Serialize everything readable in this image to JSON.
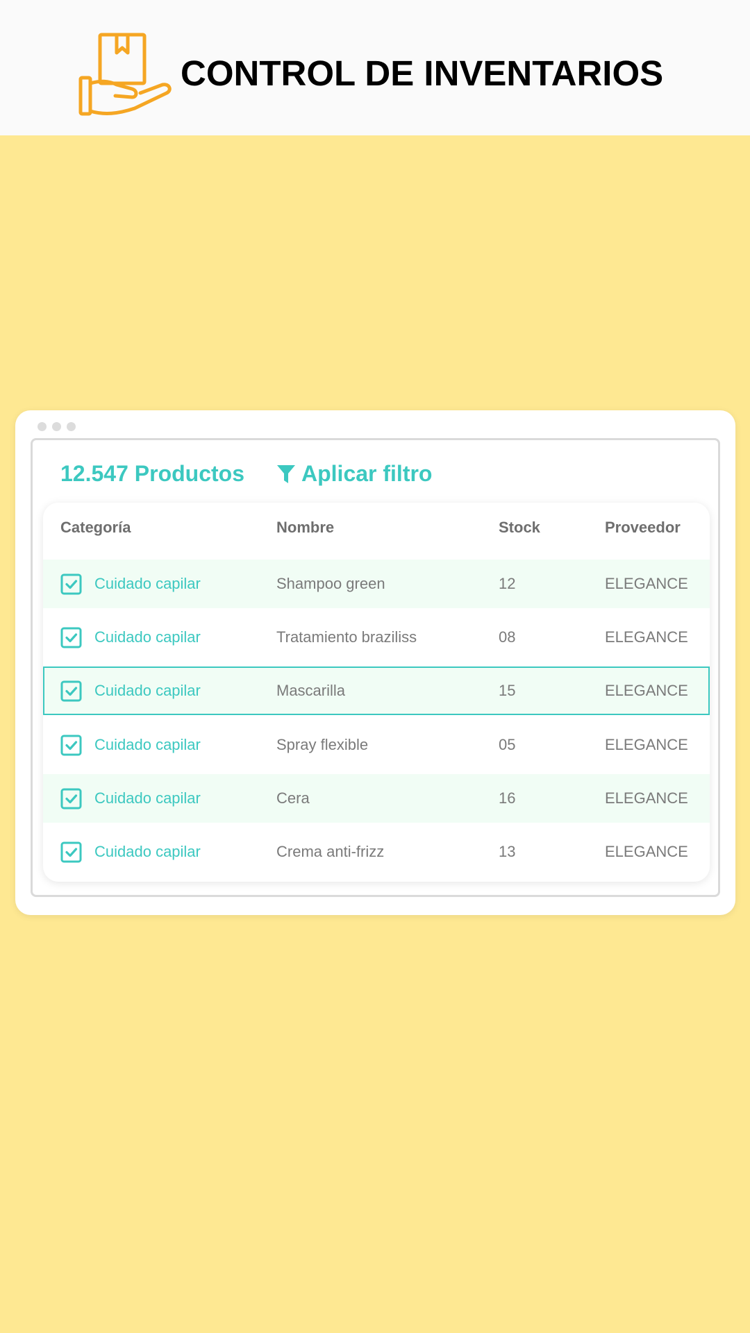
{
  "header": {
    "title": "CONTROL DE INVENTARIOS",
    "logo_icon": "hand-holding-box-icon",
    "logo_color": "#F5A623"
  },
  "window": {
    "summary": "12.547 Productos",
    "filter_label": "Aplicar filtro",
    "filter_icon": "funnel-icon",
    "accent_color": "#3CC8C0"
  },
  "table": {
    "columns": [
      "Categoría",
      "Nombre",
      "Stock",
      "Proveedor"
    ],
    "rows": [
      {
        "category": "Cuidado capilar",
        "name": "Shampoo green",
        "stock": "12",
        "provider": "ELEGANCE",
        "checked": true
      },
      {
        "category": "Cuidado capilar",
        "name": "Tratamiento braziliss",
        "stock": "08",
        "provider": "ELEGANCE",
        "checked": true
      },
      {
        "category": "Cuidado capilar",
        "name": "Mascarilla",
        "stock": "15",
        "provider": "ELEGANCE",
        "checked": true,
        "selected": true
      },
      {
        "category": "Cuidado capilar",
        "name": "Spray flexible",
        "stock": "05",
        "provider": "ELEGANCE",
        "checked": true
      },
      {
        "category": "Cuidado capilar",
        "name": "Cera",
        "stock": "16",
        "provider": "ELEGANCE",
        "checked": true
      },
      {
        "category": "Cuidado capilar",
        "name": "Crema anti-frizz",
        "stock": "13",
        "provider": "ELEGANCE",
        "checked": true
      }
    ]
  }
}
